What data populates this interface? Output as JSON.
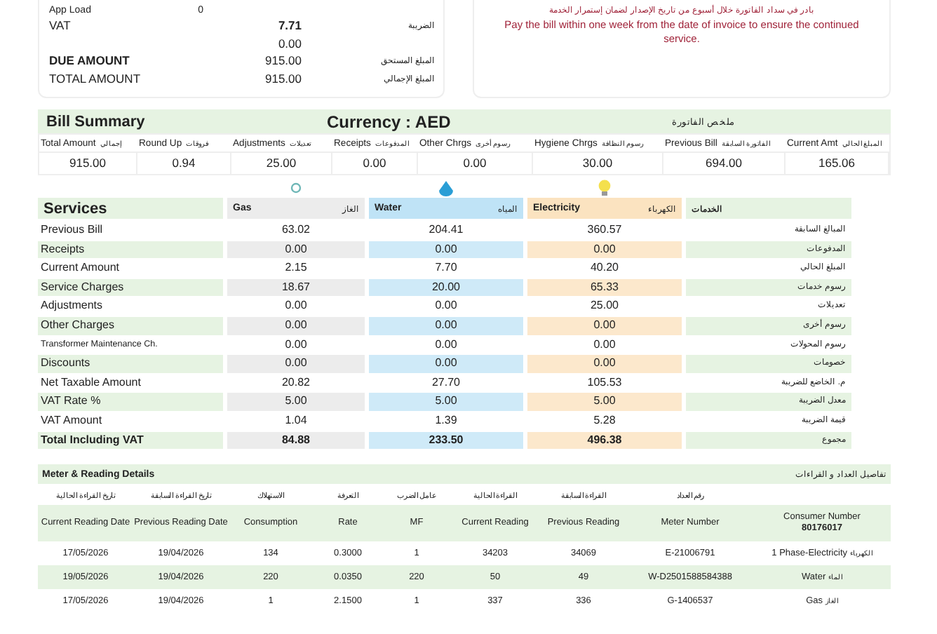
{
  "account_summary": {
    "rows": [
      {
        "kind": "small",
        "label": "App Load",
        "value": "0"
      },
      {
        "kind": "vat",
        "label": "VAT",
        "value": "7.71",
        "label_ar": "الضريبة"
      },
      {
        "kind": "plain",
        "value": "0.00"
      },
      {
        "kind": "due",
        "label": "DUE AMOUNT",
        "value": "915.00",
        "label_ar": "المبلغ المستحق"
      },
      {
        "kind": "plain",
        "label": "TOTAL AMOUNT",
        "value": "915.00",
        "label_ar": "المبلغ الإجمالي"
      }
    ]
  },
  "notice": {
    "text_ar": "بادر في سداد الفاتورة خلال أسبوع من تاريخ الإصدار لضمان إستمرار الخدمة",
    "text": "Pay the bill within one week from the date of invoice to ensure the continued service."
  },
  "bill_summary": {
    "title": "Bill Summary",
    "currency": "Currency : AED",
    "title_ar": "ملخص الفاتورة",
    "columns": [
      {
        "label": "Total Amount",
        "value": "915.00"
      },
      {
        "label": "Round Up",
        "value": "0.94"
      },
      {
        "label": "Adjustments",
        "value": "25.00"
      },
      {
        "label": "Receipts",
        "value": "0.00"
      },
      {
        "label": "Other Chrgs",
        "value": "0.00"
      },
      {
        "label": "Hygiene Chrgs",
        "value": "30.00"
      },
      {
        "label": "Previous Bill",
        "value": "694.00"
      },
      {
        "label": "Current Amt",
        "value": "165.06"
      }
    ],
    "column_labels_ar": [
      "المبلغ الحالي",
      "الفاتورة السابقة",
      "رسوم النظافة",
      "رسوم أخرى",
      "المدفوعات",
      "تعديلات",
      "فروقات",
      "إجمالي"
    ]
  },
  "services": {
    "title": "Services",
    "title_ar": "الخدمات",
    "columns": [
      {
        "kind": "gas",
        "name": "Gas"
      },
      {
        "kind": "water",
        "name": "Water"
      },
      {
        "kind": "electricity",
        "name": "Electricity"
      }
    ],
    "column_names_ar": [
      "الكهرباء",
      "المياه",
      "الغاز"
    ],
    "rows": [
      {
        "label": "Previous Bill",
        "label_ar": "المبالغ السابقة",
        "values": [
          "63.02",
          "204.41",
          "360.57"
        ],
        "total": false
      },
      {
        "label": "Receipts",
        "label_ar": "المدفوعات",
        "values": [
          "0.00",
          "0.00",
          "0.00"
        ],
        "total": false
      },
      {
        "label": "Current Amount",
        "label_ar": "المبلغ الحالي",
        "values": [
          "2.15",
          "7.70",
          "40.20"
        ],
        "total": false
      },
      {
        "label": "Service Charges",
        "label_ar": "رسوم خدمات",
        "values": [
          "18.67",
          "20.00",
          "65.33"
        ],
        "total": false
      },
      {
        "label": "Adjustments",
        "label_ar": "تعديلات",
        "values": [
          "0.00",
          "0.00",
          "25.00"
        ],
        "total": false
      },
      {
        "label": "Other Charges",
        "label_ar": "رسوم أخرى",
        "values": [
          "0.00",
          "0.00",
          "0.00"
        ],
        "total": false
      },
      {
        "label": "Transformer Maintenance Ch.",
        "label_ar": "رسوم المحولات",
        "values": [
          "0.00",
          "0.00",
          "0.00"
        ],
        "total": false
      },
      {
        "label": "Discounts",
        "label_ar": "خصومات",
        "values": [
          "0.00",
          "0.00",
          "0.00"
        ],
        "total": false
      },
      {
        "label": "Net Taxable Amount",
        "label_ar": "م. الخاضع للضريبة",
        "values": [
          "20.82",
          "27.70",
          "105.53"
        ],
        "total": false
      },
      {
        "label": "VAT Rate %",
        "label_ar": "معدل الضريبة",
        "values": [
          "5.00",
          "5.00",
          "5.00"
        ],
        "total": false
      },
      {
        "label": "VAT Amount",
        "label_ar": "قيمة الضريبة",
        "values": [
          "1.04",
          "1.39",
          "5.28"
        ],
        "total": false
      },
      {
        "label": "Total Including VAT",
        "label_ar": "مجموع",
        "values": [
          "84.88",
          "233.50",
          "496.38"
        ],
        "total": true
      }
    ]
  },
  "meter_details": {
    "title": "Meter & Reading Details",
    "title_ar": "تفاصيل العداد و القراءات",
    "columns": [
      {
        "label_ar": "تاريخ القراءة الحالية",
        "label": "Current Reading Date"
      },
      {
        "label_ar": "تاريخ القراءة السابقة",
        "label": "Previous Reading Date"
      },
      {
        "label_ar": "الاستهلاك",
        "label": "Consumption"
      },
      {
        "label_ar": "التعرفة",
        "label": "Rate"
      },
      {
        "label_ar": "عامل الضرب",
        "label": "MF"
      },
      {
        "label_ar": "القراءة الحالية",
        "label": "Current Reading"
      },
      {
        "label_ar": "القراءة السابقة",
        "label": "Previous Reading"
      },
      {
        "label_ar": "رقم العداد",
        "label": "Meter Number"
      },
      {
        "label": "Consumer Number",
        "value": "80176017"
      }
    ],
    "rows": [
      {
        "cells": [
          "17/05/2026",
          "19/04/2026",
          "134",
          "0.3000",
          "1",
          "34203",
          "34069",
          "E-21006791"
        ],
        "service": "1 Phase-Electricity",
        "service_ar": "الكهرباء"
      },
      {
        "cells": [
          "19/05/2026",
          "19/04/2026",
          "220",
          "0.0350",
          "220",
          "50",
          "49",
          "W-D2501588584388"
        ],
        "service": "Water",
        "service_ar": "الماء"
      },
      {
        "cells": [
          "17/05/2026",
          "19/04/2026",
          "1",
          "2.1500",
          "1",
          "337",
          "336",
          "G-1406537"
        ],
        "service": "Gas",
        "service_ar": "الغاز"
      }
    ]
  }
}
